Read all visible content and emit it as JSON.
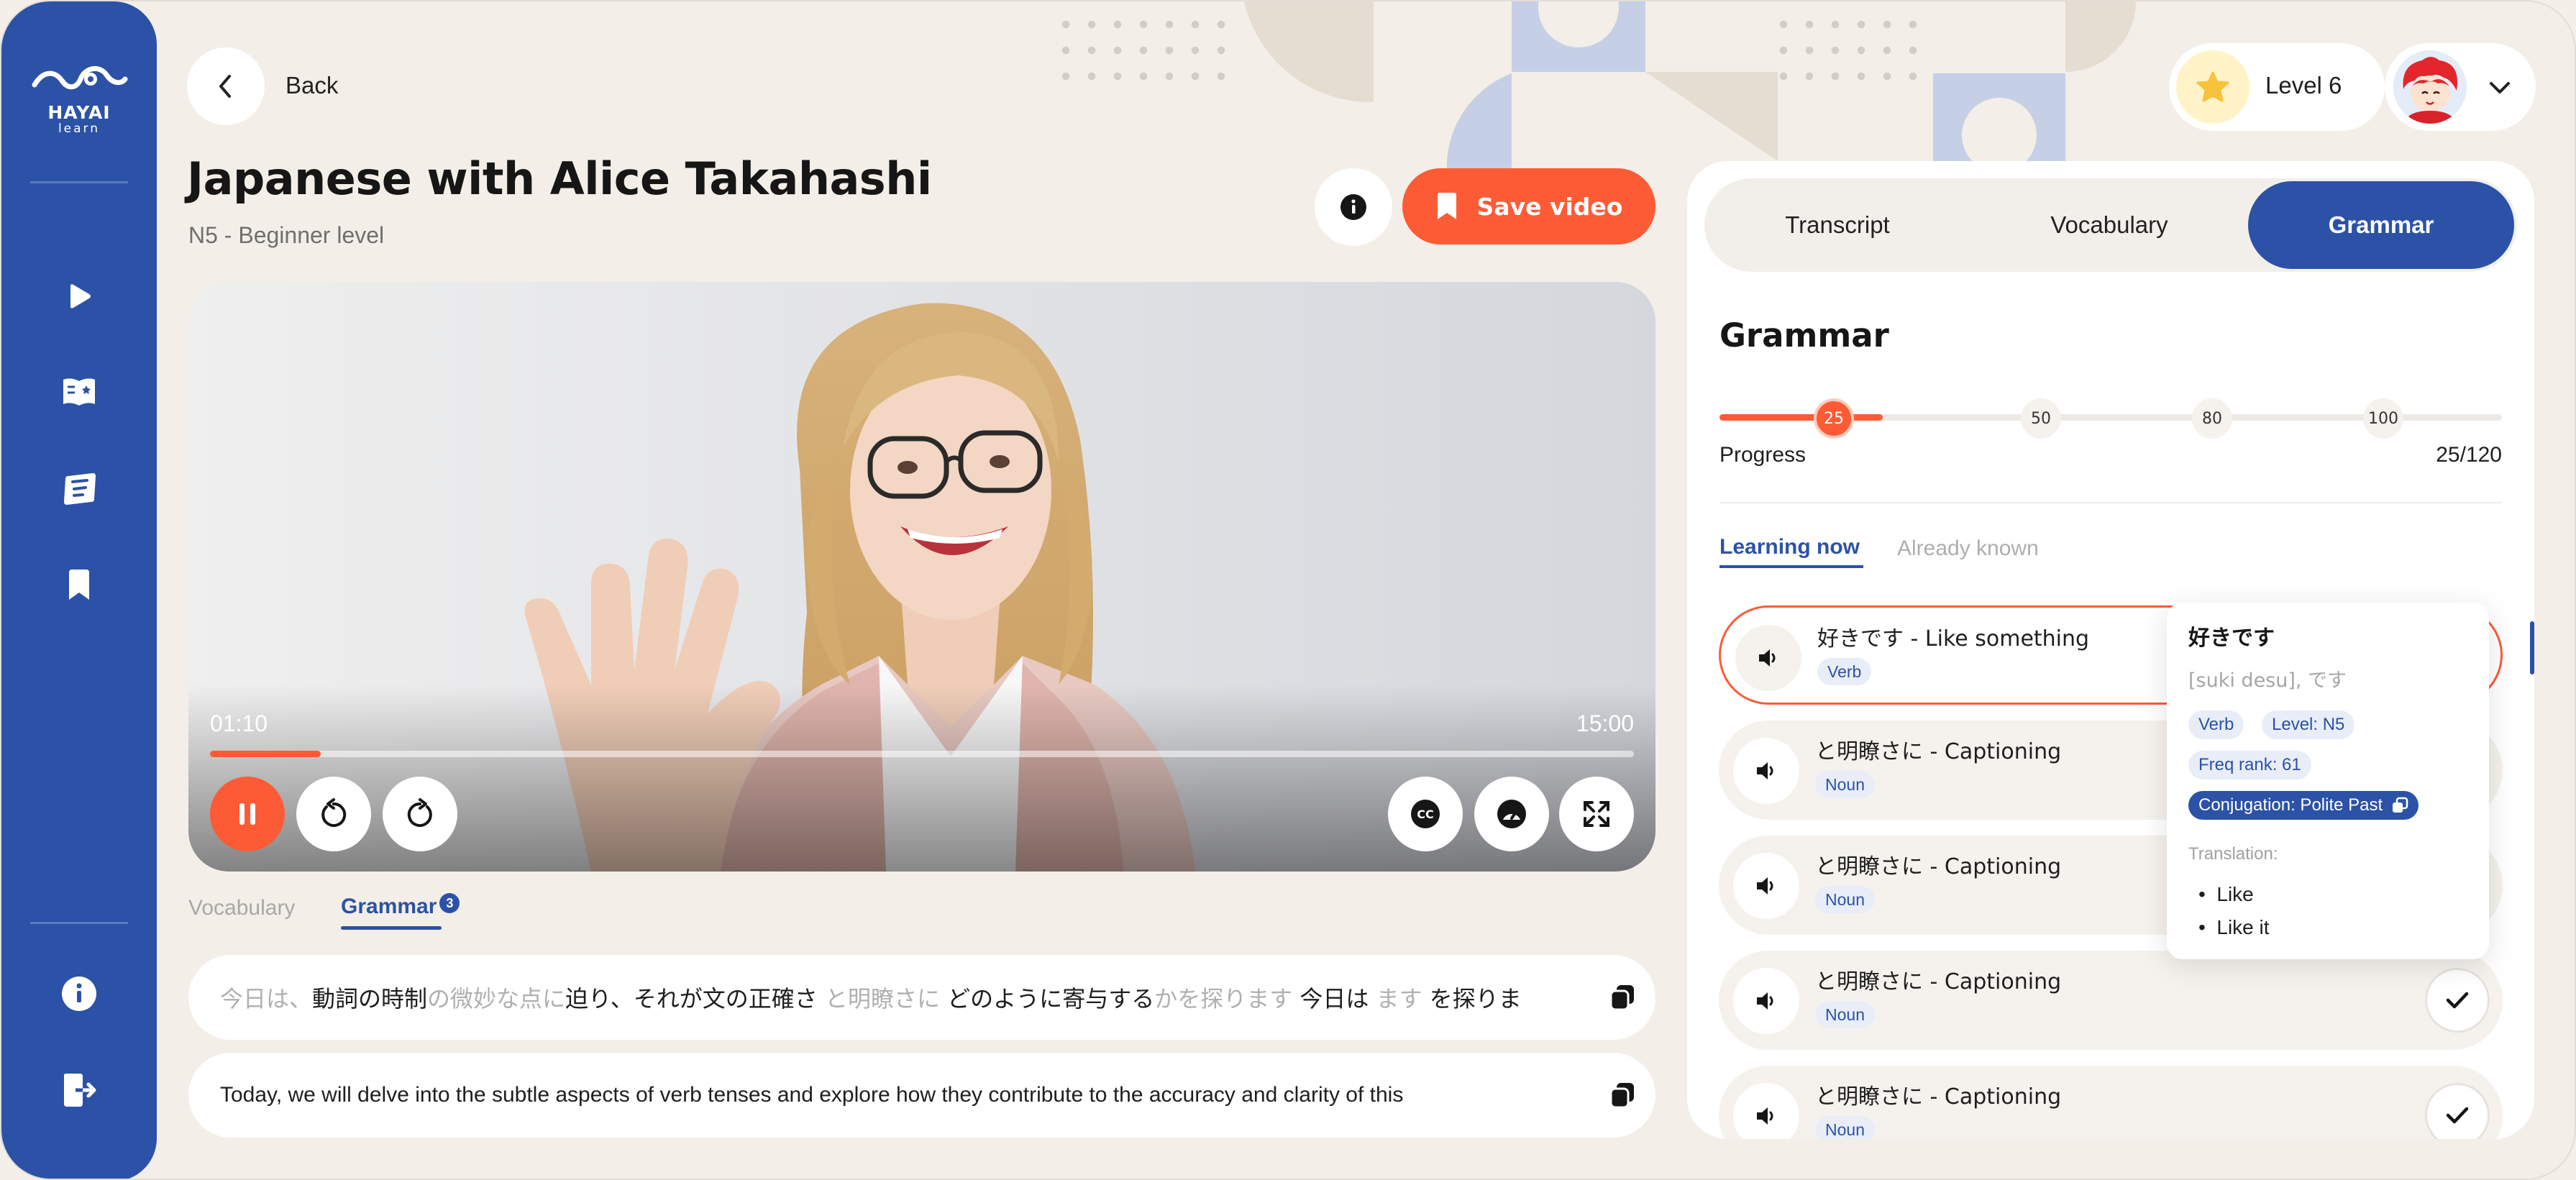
{
  "brand": {
    "name": "HAYAI",
    "sub": "learn"
  },
  "header": {
    "back_label": "Back",
    "title": "Japanese with Alice Takahashi",
    "subtitle": "N5 - Beginner level",
    "save_label": "Save video",
    "level_label": "Level 6"
  },
  "video": {
    "current_time": "01:10",
    "duration": "15:00",
    "progress": 0.078
  },
  "subtabs": {
    "vocabulary": "Vocabulary",
    "grammar": "Grammar",
    "grammar_count": "3"
  },
  "transcript": {
    "japanese_segments": [
      {
        "t": "今日は、",
        "s": "g"
      },
      {
        "t": "動詞",
        "s": "u"
      },
      {
        "t": "の時制",
        "s": "k"
      },
      {
        "t": "の微妙な点に",
        "s": "g"
      },
      {
        "t": "迫り",
        "s": "u"
      },
      {
        "t": "、それが文の正確さ ",
        "s": "k"
      },
      {
        "t": "と明瞭さに",
        "s": "ug"
      },
      {
        "t": " どのように",
        "s": "k"
      },
      {
        "t": "寄与する",
        "s": "u"
      },
      {
        "t": "かを探ります ",
        "s": "g"
      },
      {
        "t": "今日は",
        "s": "u"
      },
      {
        "t": " ます ",
        "s": "g"
      },
      {
        "t": "を探りま",
        "s": "k"
      }
    ],
    "english": "Today, we will delve into the subtle aspects of verb tenses and  explore  how they contribute to the accuracy and clarity of this"
  },
  "panel": {
    "tabs": [
      "Transcript",
      "Vocabulary",
      "Grammar"
    ],
    "active_tab": "Grammar",
    "title": "Grammar",
    "milestones": [
      "25",
      "50",
      "80",
      "100"
    ],
    "progress_label": "Progress",
    "progress_value": "25/120",
    "progress_fraction": 0.2083,
    "learning_now": "Learning now",
    "already_known": "Already known",
    "items": [
      {
        "text": "好きです  -  Like something",
        "tag": "Verb"
      },
      {
        "text": "と明瞭さに  -  Captioning",
        "tag": "Noun"
      },
      {
        "text": "と明瞭さに  -  Captioning",
        "tag": "Noun"
      },
      {
        "text": "と明瞭さに  -  Captioning",
        "tag": "Noun"
      },
      {
        "text": "と明瞭さに  -  Captioning",
        "tag": "Noun"
      }
    ]
  },
  "popover": {
    "title": "好きです",
    "reading": "[suki desu], です",
    "chips": [
      "Verb",
      "Level: N5",
      "Freq rank: 61"
    ],
    "conjugation": "Conjugation: Polite Past",
    "translation_label": "Translation:",
    "translations": [
      "Like",
      "Like it"
    ]
  },
  "colors": {
    "primary": "#2b52a6",
    "accent": "#fd5b36",
    "background": "#f3eee8"
  },
  "icons": [
    "play-icon",
    "book-icon",
    "cards-icon",
    "bookmark-icon",
    "info-icon",
    "logout-icon",
    "chevron-left-icon",
    "star-icon",
    "chevron-down-icon",
    "speaker-icon",
    "check-icon",
    "copy-icon",
    "pause-icon",
    "rewind-icon",
    "forward-icon",
    "cc-icon",
    "speed-icon",
    "fullscreen-icon"
  ]
}
